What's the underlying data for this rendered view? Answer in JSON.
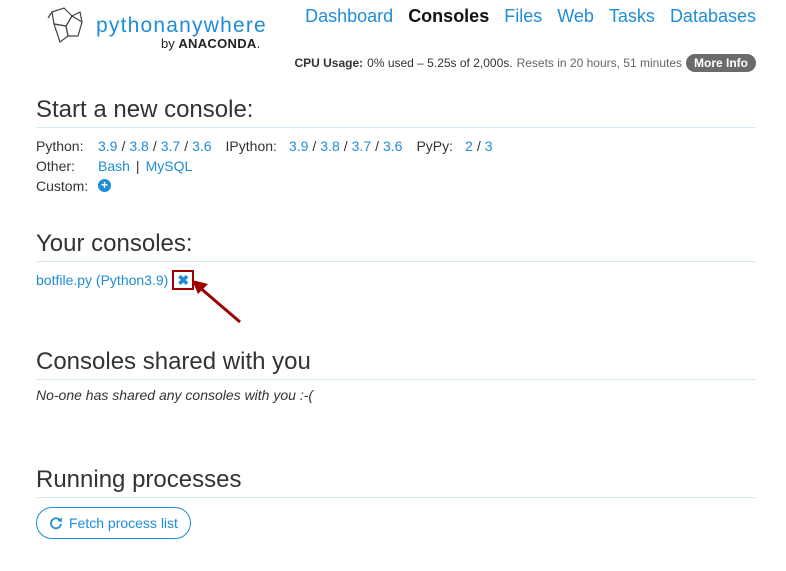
{
  "logo": {
    "name": "pythonanywhere",
    "by": "by",
    "brand": "ANACONDA",
    "brand_dot": "."
  },
  "nav": [
    {
      "label": "Dashboard",
      "active": false
    },
    {
      "label": "Consoles",
      "active": true
    },
    {
      "label": "Files",
      "active": false
    },
    {
      "label": "Web",
      "active": false
    },
    {
      "label": "Tasks",
      "active": false
    },
    {
      "label": "Databases",
      "active": false
    }
  ],
  "cpu": {
    "label": "CPU Usage:",
    "usage": "0% used – 5.25s of 2,000s.",
    "resets": "Resets in 20 hours, 51 minutes",
    "more_info": "More Info"
  },
  "start": {
    "title": "Start a new console:",
    "python_label": "Python:",
    "python_versions": [
      "3.9",
      "3.8",
      "3.7",
      "3.6"
    ],
    "ipython_label": "IPython:",
    "ipython_versions": [
      "3.9",
      "3.8",
      "3.7",
      "3.6"
    ],
    "pypy_label": "PyPy:",
    "pypy_versions": [
      "2",
      "3"
    ],
    "other_label": "Other:",
    "other_items": [
      "Bash",
      "MySQL"
    ],
    "custom_label": "Custom:"
  },
  "your_consoles": {
    "title": "Your consoles:",
    "items": [
      {
        "label": "botfile.py (Python3.9)"
      }
    ]
  },
  "shared": {
    "title": "Consoles shared with you",
    "empty": "No-one has shared any consoles with you :-("
  },
  "processes": {
    "title": "Running processes",
    "fetch_label": "Fetch process list"
  },
  "colors": {
    "link": "#1f8dd6",
    "highlight": "#a00000"
  }
}
